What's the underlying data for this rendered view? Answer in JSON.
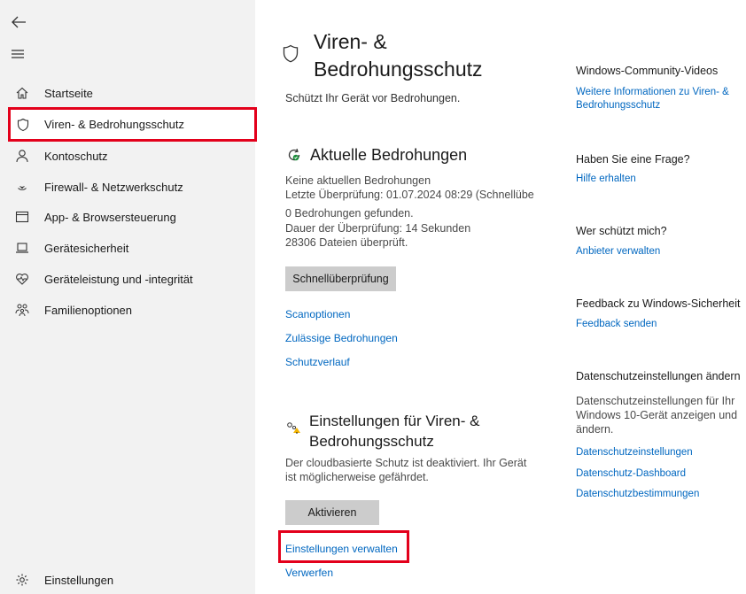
{
  "sidebar": {
    "items": [
      {
        "label": "Startseite",
        "icon": "home-icon"
      },
      {
        "label": "Viren- & Bedrohungsschutz",
        "icon": "shield-icon"
      },
      {
        "label": "Kontoschutz",
        "icon": "person-icon"
      },
      {
        "label": "Firewall- & Netzwerkschutz",
        "icon": "wifi-icon"
      },
      {
        "label": "App- & Browsersteuerung",
        "icon": "app-window-icon"
      },
      {
        "label": "Gerätesicherheit",
        "icon": "laptop-icon"
      },
      {
        "label": "Geräteleistung und -integrität",
        "icon": "heart-icon"
      },
      {
        "label": "Familienoptionen",
        "icon": "family-icon"
      }
    ],
    "settings_label": "Einstellungen"
  },
  "main": {
    "title": "Viren- & Bedrohungsschutz",
    "subtitle": "Schützt Ihr Gerät vor Bedrohungen.",
    "threats": {
      "title": "Aktuelle Bedrohungen",
      "lines": [
        "Keine aktuellen Bedrohungen",
        "Letzte Überprüfung: 01.07.2024 08:29 (Schnellübe",
        "0 Bedrohungen gefunden.",
        "Dauer der Überprüfung: 14 Sekunden",
        "28306 Dateien überprüft."
      ],
      "scan_button": "Schnellüberprüfung",
      "links": [
        "Scanoptionen",
        "Zulässige Bedrohungen",
        "Schutzverlauf"
      ]
    },
    "settings": {
      "title": "Einstellungen für Viren- & Bedrohungsschutz",
      "title_line1": "Einstellungen für Viren- &",
      "title_line2": "Bedrohungsschutz",
      "desc_line1": "Der cloudbasierte Schutz ist deaktiviert. Ihr Gerät",
      "desc_line2": "ist möglicherweise gefährdet.",
      "activate_button": "Aktivieren",
      "manage_link": "Einstellungen verwalten",
      "dismiss_link": "Verwerfen"
    }
  },
  "right": {
    "videos_heading": "Windows-Community-Videos",
    "videos_link_line1": "Weitere Informationen zu Viren- &",
    "videos_link_line2": "Bedrohungsschutz",
    "question_heading": "Haben Sie eine Frage?",
    "question_link": "Hilfe erhalten",
    "who_heading": "Wer schützt mich?",
    "who_link": "Anbieter verwalten",
    "feedback_heading": "Feedback zu Windows-Sicherheit",
    "feedback_link": "Feedback senden",
    "privacy_heading": "Datenschutzeinstellungen ändern",
    "privacy_text_line1": "Datenschutzeinstellungen für Ihr",
    "privacy_text_line2": "Windows 10-Gerät anzeigen und",
    "privacy_text_line3": "ändern.",
    "privacy_links": [
      "Datenschutzeinstellungen",
      "Datenschutz-Dashboard",
      "Datenschutzbestimmungen"
    ]
  },
  "colors": {
    "link": "#0067c0",
    "highlight": "#e3001b",
    "sidebar_bg": "#f2f2f2",
    "button_bg": "#cccccc"
  }
}
